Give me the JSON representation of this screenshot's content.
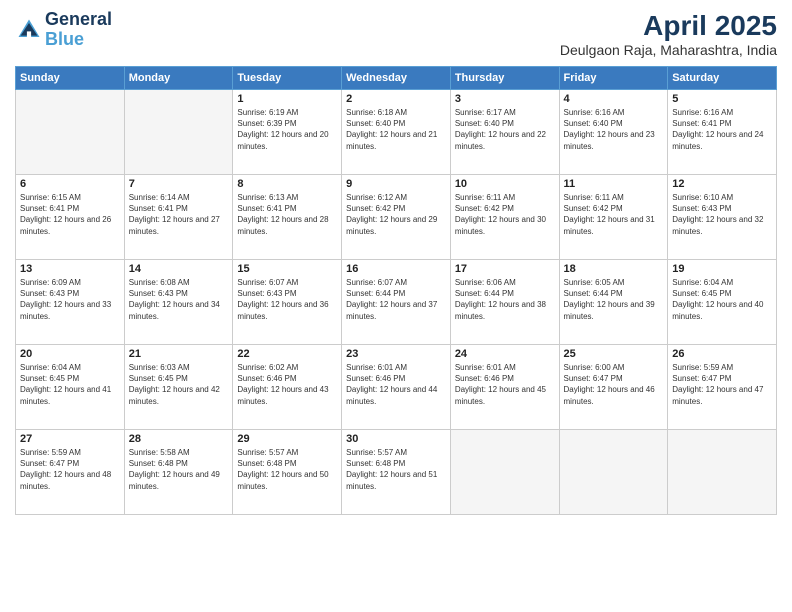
{
  "header": {
    "logo_line1": "General",
    "logo_line2": "Blue",
    "month": "April 2025",
    "location": "Deulgaon Raja, Maharashtra, India"
  },
  "weekdays": [
    "Sunday",
    "Monday",
    "Tuesday",
    "Wednesday",
    "Thursday",
    "Friday",
    "Saturday"
  ],
  "weeks": [
    [
      {
        "day": "",
        "empty": true
      },
      {
        "day": "",
        "empty": true
      },
      {
        "day": "1",
        "sunrise": "6:19 AM",
        "sunset": "6:39 PM",
        "daylight": "12 hours and 20 minutes."
      },
      {
        "day": "2",
        "sunrise": "6:18 AM",
        "sunset": "6:40 PM",
        "daylight": "12 hours and 21 minutes."
      },
      {
        "day": "3",
        "sunrise": "6:17 AM",
        "sunset": "6:40 PM",
        "daylight": "12 hours and 22 minutes."
      },
      {
        "day": "4",
        "sunrise": "6:16 AM",
        "sunset": "6:40 PM",
        "daylight": "12 hours and 23 minutes."
      },
      {
        "day": "5",
        "sunrise": "6:16 AM",
        "sunset": "6:41 PM",
        "daylight": "12 hours and 24 minutes."
      }
    ],
    [
      {
        "day": "6",
        "sunrise": "6:15 AM",
        "sunset": "6:41 PM",
        "daylight": "12 hours and 26 minutes."
      },
      {
        "day": "7",
        "sunrise": "6:14 AM",
        "sunset": "6:41 PM",
        "daylight": "12 hours and 27 minutes."
      },
      {
        "day": "8",
        "sunrise": "6:13 AM",
        "sunset": "6:41 PM",
        "daylight": "12 hours and 28 minutes."
      },
      {
        "day": "9",
        "sunrise": "6:12 AM",
        "sunset": "6:42 PM",
        "daylight": "12 hours and 29 minutes."
      },
      {
        "day": "10",
        "sunrise": "6:11 AM",
        "sunset": "6:42 PM",
        "daylight": "12 hours and 30 minutes."
      },
      {
        "day": "11",
        "sunrise": "6:11 AM",
        "sunset": "6:42 PM",
        "daylight": "12 hours and 31 minutes."
      },
      {
        "day": "12",
        "sunrise": "6:10 AM",
        "sunset": "6:43 PM",
        "daylight": "12 hours and 32 minutes."
      }
    ],
    [
      {
        "day": "13",
        "sunrise": "6:09 AM",
        "sunset": "6:43 PM",
        "daylight": "12 hours and 33 minutes."
      },
      {
        "day": "14",
        "sunrise": "6:08 AM",
        "sunset": "6:43 PM",
        "daylight": "12 hours and 34 minutes."
      },
      {
        "day": "15",
        "sunrise": "6:07 AM",
        "sunset": "6:43 PM",
        "daylight": "12 hours and 36 minutes."
      },
      {
        "day": "16",
        "sunrise": "6:07 AM",
        "sunset": "6:44 PM",
        "daylight": "12 hours and 37 minutes."
      },
      {
        "day": "17",
        "sunrise": "6:06 AM",
        "sunset": "6:44 PM",
        "daylight": "12 hours and 38 minutes."
      },
      {
        "day": "18",
        "sunrise": "6:05 AM",
        "sunset": "6:44 PM",
        "daylight": "12 hours and 39 minutes."
      },
      {
        "day": "19",
        "sunrise": "6:04 AM",
        "sunset": "6:45 PM",
        "daylight": "12 hours and 40 minutes."
      }
    ],
    [
      {
        "day": "20",
        "sunrise": "6:04 AM",
        "sunset": "6:45 PM",
        "daylight": "12 hours and 41 minutes."
      },
      {
        "day": "21",
        "sunrise": "6:03 AM",
        "sunset": "6:45 PM",
        "daylight": "12 hours and 42 minutes."
      },
      {
        "day": "22",
        "sunrise": "6:02 AM",
        "sunset": "6:46 PM",
        "daylight": "12 hours and 43 minutes."
      },
      {
        "day": "23",
        "sunrise": "6:01 AM",
        "sunset": "6:46 PM",
        "daylight": "12 hours and 44 minutes."
      },
      {
        "day": "24",
        "sunrise": "6:01 AM",
        "sunset": "6:46 PM",
        "daylight": "12 hours and 45 minutes."
      },
      {
        "day": "25",
        "sunrise": "6:00 AM",
        "sunset": "6:47 PM",
        "daylight": "12 hours and 46 minutes."
      },
      {
        "day": "26",
        "sunrise": "5:59 AM",
        "sunset": "6:47 PM",
        "daylight": "12 hours and 47 minutes."
      }
    ],
    [
      {
        "day": "27",
        "sunrise": "5:59 AM",
        "sunset": "6:47 PM",
        "daylight": "12 hours and 48 minutes."
      },
      {
        "day": "28",
        "sunrise": "5:58 AM",
        "sunset": "6:48 PM",
        "daylight": "12 hours and 49 minutes."
      },
      {
        "day": "29",
        "sunrise": "5:57 AM",
        "sunset": "6:48 PM",
        "daylight": "12 hours and 50 minutes."
      },
      {
        "day": "30",
        "sunrise": "5:57 AM",
        "sunset": "6:48 PM",
        "daylight": "12 hours and 51 minutes."
      },
      {
        "day": "",
        "empty": true
      },
      {
        "day": "",
        "empty": true
      },
      {
        "day": "",
        "empty": true
      }
    ]
  ]
}
